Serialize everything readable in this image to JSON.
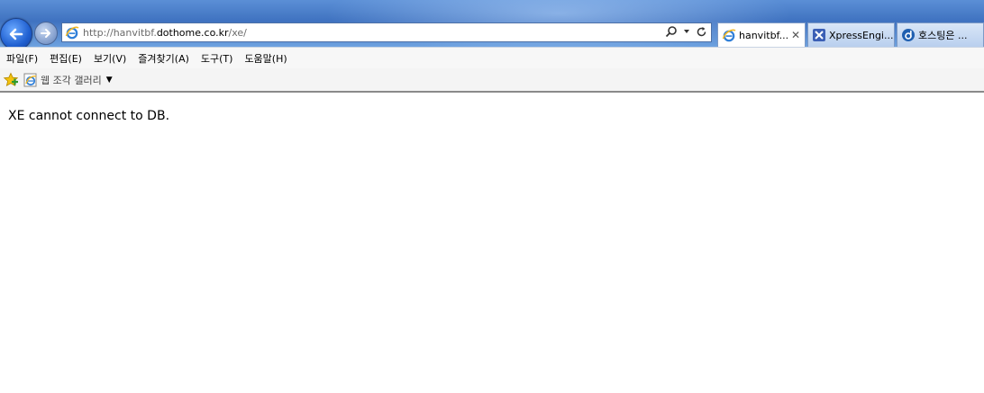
{
  "address_bar": {
    "url_prefix": "http://hanvitbf.",
    "url_domain": "dothome.co.kr",
    "url_suffix": "/xe/"
  },
  "tabs": [
    {
      "label": "hanvitbf...",
      "active": true,
      "icon": "ie-icon"
    },
    {
      "label": "XpressEngi...",
      "active": false,
      "icon": "xe-icon"
    },
    {
      "label": "호스팅은 ...",
      "active": false,
      "icon": "dothome-icon"
    }
  ],
  "menu": [
    {
      "label": "파일(F)"
    },
    {
      "label": "편집(E)"
    },
    {
      "label": "보기(V)"
    },
    {
      "label": "즐겨찾기(A)"
    },
    {
      "label": "도구(T)"
    },
    {
      "label": "도움말(H)"
    }
  ],
  "favorites_bar": {
    "gallery_label": "웹 조각 갤러리"
  },
  "page": {
    "message": "XE cannot connect to DB."
  },
  "colors": {
    "chrome_blue": "#3f72c0",
    "page_background": "#ffffff"
  }
}
